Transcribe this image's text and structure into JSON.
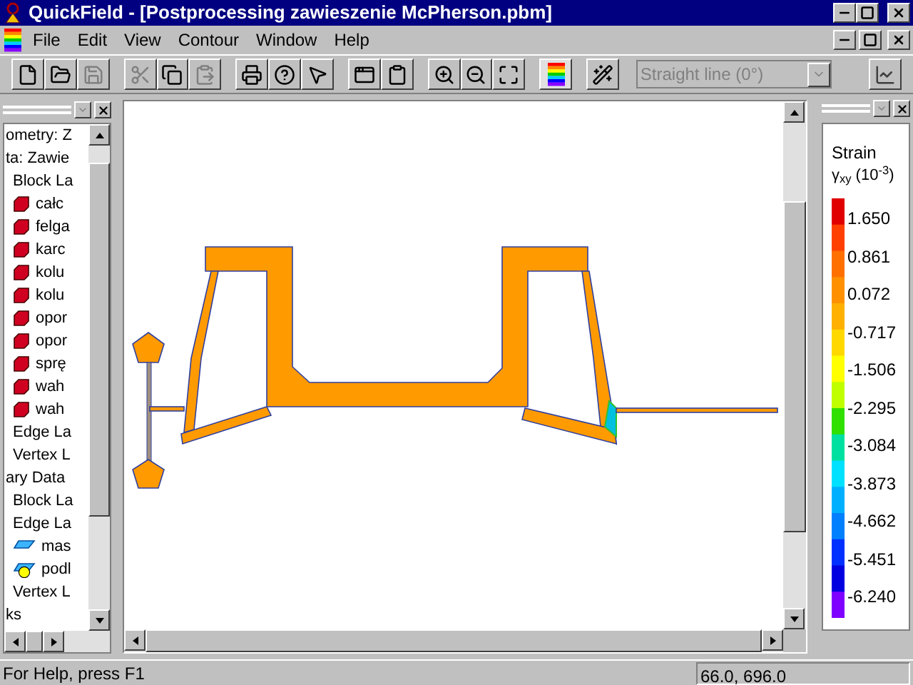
{
  "window": {
    "title": "QuickField - [Postprocessing zawieszenie McPherson.pbm]"
  },
  "menu": [
    "File",
    "Edit",
    "View",
    "Contour",
    "Window",
    "Help"
  ],
  "toolbar": [
    {
      "kind": "new",
      "disabled": false
    },
    {
      "kind": "open",
      "disabled": false
    },
    {
      "kind": "save",
      "disabled": true
    },
    {
      "kind": "sep"
    },
    {
      "kind": "cut",
      "disabled": true
    },
    {
      "kind": "copy",
      "disabled": false
    },
    {
      "kind": "paste",
      "disabled": true
    },
    {
      "kind": "sep"
    },
    {
      "kind": "print",
      "disabled": false
    },
    {
      "kind": "help",
      "disabled": false
    },
    {
      "kind": "context-help",
      "disabled": false
    },
    {
      "kind": "sep"
    },
    {
      "kind": "windows",
      "disabled": false
    },
    {
      "kind": "clipboard",
      "disabled": false
    },
    {
      "kind": "sep"
    },
    {
      "kind": "zoom-in",
      "disabled": false
    },
    {
      "kind": "zoom-out",
      "disabled": false
    },
    {
      "kind": "fit",
      "disabled": false
    },
    {
      "kind": "sep"
    },
    {
      "kind": "color-map",
      "disabled": false
    },
    {
      "kind": "sep"
    },
    {
      "kind": "wand",
      "disabled": false
    }
  ],
  "contour_select": {
    "value": "Straight line (0°)",
    "disabled": true
  },
  "tree": [
    {
      "label": "ometry: Z"
    },
    {
      "label": "ta: Zawie",
      "children": [
        {
          "label": "Block La",
          "children": [
            {
              "label": "całc",
              "kind": "block"
            },
            {
              "label": "felga",
              "kind": "block"
            },
            {
              "label": "karc",
              "kind": "block"
            },
            {
              "label": "kolu",
              "kind": "block"
            },
            {
              "label": "kolu",
              "kind": "block"
            },
            {
              "label": "opor",
              "kind": "block"
            },
            {
              "label": "opor",
              "kind": "block"
            },
            {
              "label": "sprę",
              "kind": "block"
            },
            {
              "label": "wah",
              "kind": "block"
            },
            {
              "label": "wah",
              "kind": "block"
            }
          ]
        },
        {
          "label": "Edge La"
        },
        {
          "label": "Vertex L"
        }
      ]
    },
    {
      "label": "ary Data",
      "children": [
        {
          "label": "Block La"
        },
        {
          "label": "Edge La",
          "children": [
            {
              "label": "mas",
              "kind": "edge"
            },
            {
              "label": "podl",
              "kind": "edge-fixed"
            }
          ]
        },
        {
          "label": "Vertex L"
        }
      ]
    },
    {
      "label": "ks"
    }
  ],
  "legend": {
    "title": "Strain",
    "quantity": "γ$_{xy}$ (10$^{-3}$)",
    "labels": [
      "1.650",
      "0.861",
      "0.072",
      "-0.717",
      "-1.506",
      "-2.295",
      "-3.084",
      "-3.873",
      "-4.662",
      "-5.451",
      "-6.240"
    ]
  },
  "status_bar": {
    "message": "For Help, press F1",
    "coordinates": "66.0, 696.0"
  }
}
